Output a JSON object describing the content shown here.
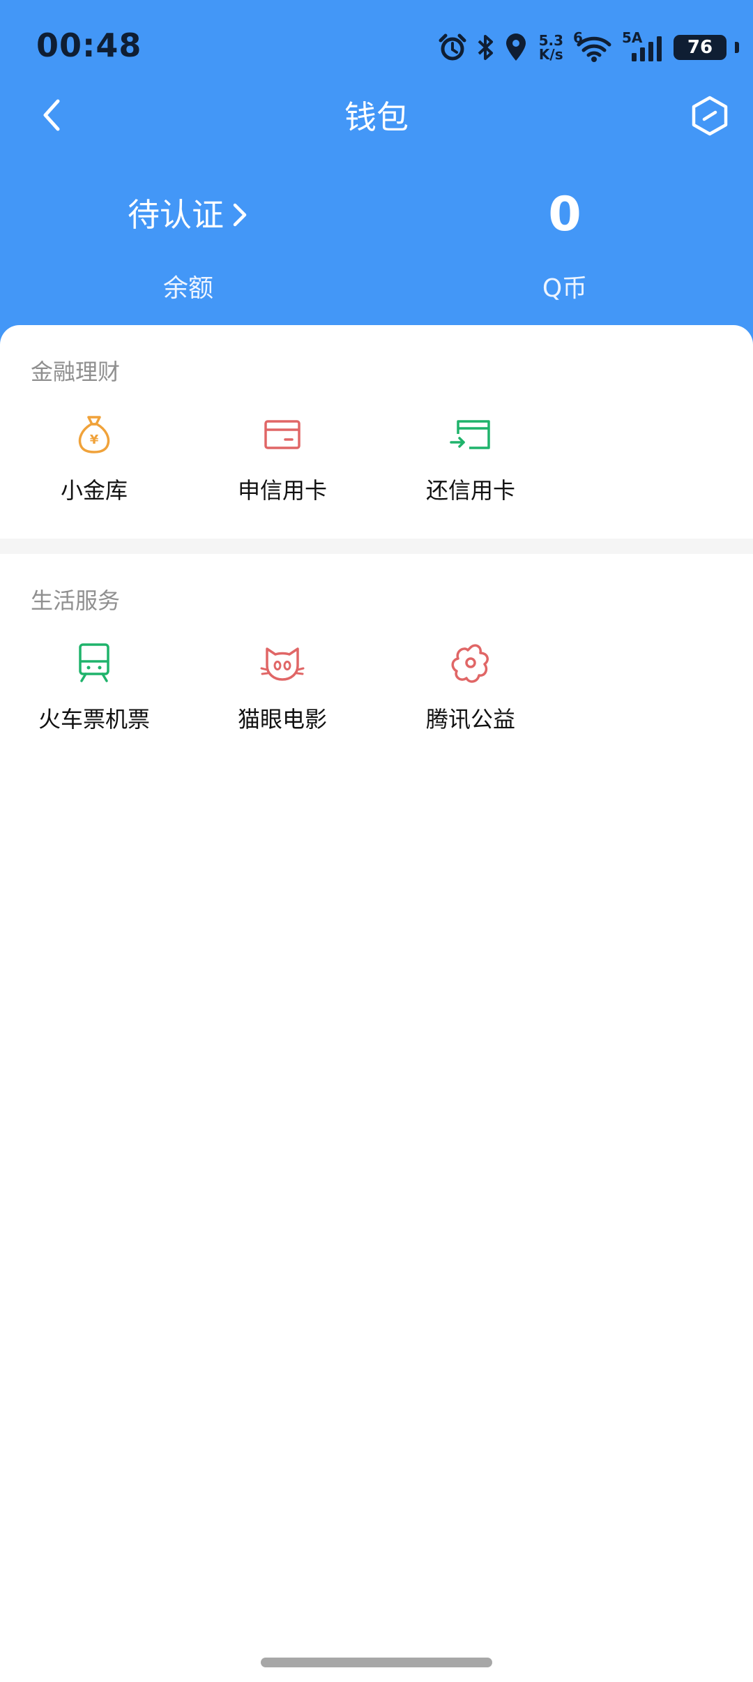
{
  "status_bar": {
    "time": "00:48",
    "net_speed_value": "5.3",
    "net_speed_unit": "K/s",
    "wifi_badge": "6",
    "cell_badge": "5A",
    "battery": "76"
  },
  "nav": {
    "title": "钱包"
  },
  "balance": {
    "value": "待认证",
    "label": "余额"
  },
  "qcoin": {
    "value": "0",
    "label": "Q币"
  },
  "finance": {
    "title": "金融理财",
    "items": [
      {
        "label": "小金库"
      },
      {
        "label": "申信用卡"
      },
      {
        "label": "还信用卡"
      }
    ]
  },
  "life": {
    "title": "生活服务",
    "items": [
      {
        "label": "火车票机票"
      },
      {
        "label": "猫眼电影"
      },
      {
        "label": "腾讯公益"
      }
    ]
  },
  "colors": {
    "header_bg": "#4397f7",
    "gold": "#f0a23a",
    "red": "#e06666",
    "green": "#1fb36b"
  }
}
